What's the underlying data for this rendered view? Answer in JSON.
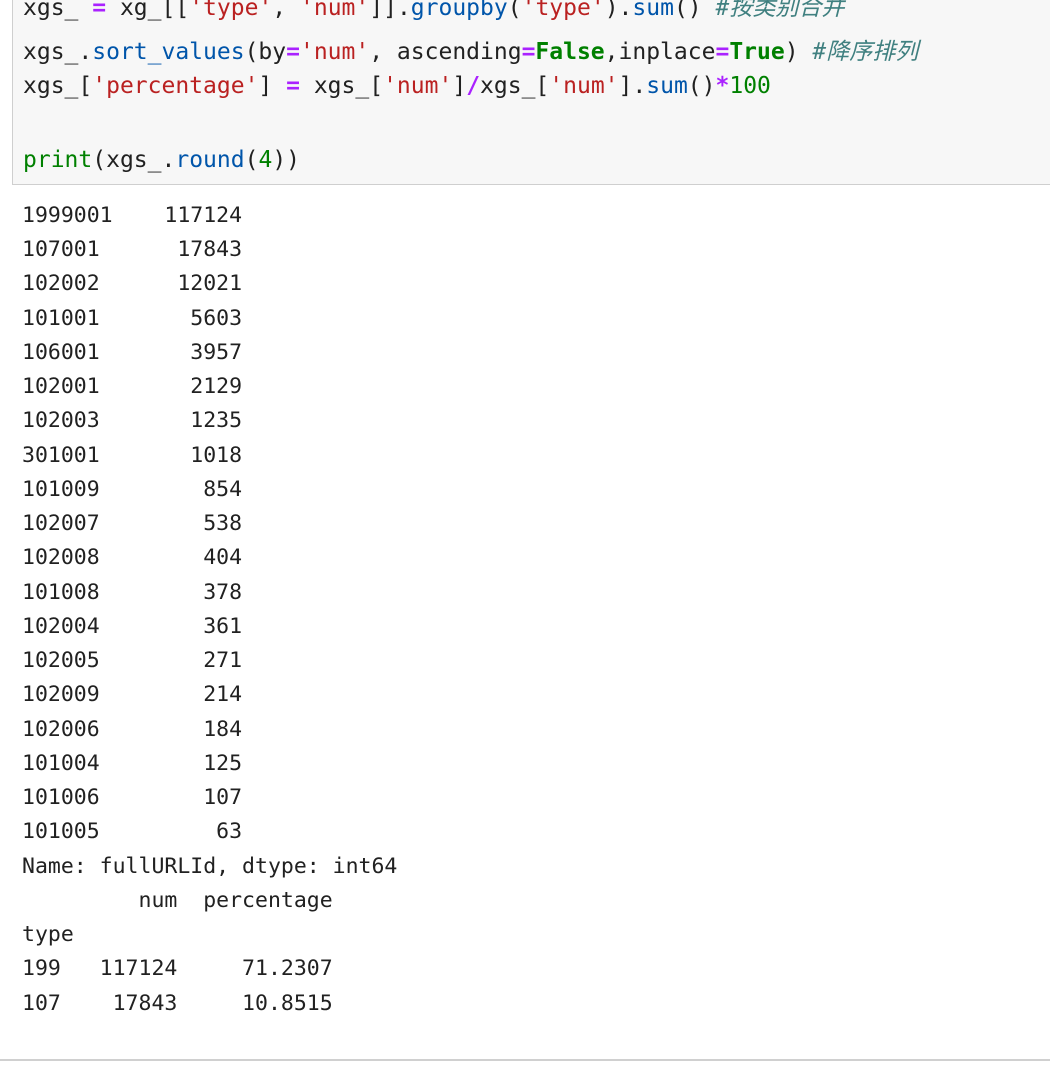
{
  "code": {
    "line1": {
      "a": "xgs_ ",
      "eq": "=",
      "b": " xg_[[",
      "s1": "'type'",
      "c": ", ",
      "s2": "'num'",
      "d": "]].",
      "m1": "groupby",
      "e": "(",
      "s3": "'type'",
      "f": ").",
      "m2": "sum",
      "g": "() ",
      "comment": "#按类别合并"
    },
    "line2": {
      "a": "xgs_.",
      "m1": "sort_values",
      "b": "(by",
      "eq1": "=",
      "s1": "'num'",
      "c": ", ascending",
      "eq2": "=",
      "k1": "False",
      "d": ",inplace",
      "eq3": "=",
      "k2": "True",
      "e": ") ",
      "comment": "#降序排列"
    },
    "line3": {
      "a": "xgs_[",
      "s1": "'percentage'",
      "b": "] ",
      "eq": "=",
      "c": " xgs_[",
      "s2": "'num'",
      "d": "]",
      "div": "/",
      "e": "xgs_[",
      "s3": "'num'",
      "f": "].",
      "m1": "sum",
      "g": "()",
      "mul": "*",
      "n": "100"
    },
    "line5": {
      "print": "print",
      "a": "(xgs_.",
      "m1": "round",
      "b": "(",
      "n": "4",
      "c": "))"
    }
  },
  "output": {
    "series_rows": [
      "1999001    117124",
      "107001      17843",
      "102002      12021",
      "101001       5603",
      "106001       3957",
      "102001       2129",
      "102003       1235",
      "301001       1018",
      "101009        854",
      "102007        538",
      "102008        404",
      "101008        378",
      "102004        361",
      "102005        271",
      "102009        214",
      "102006        184",
      "101004        125",
      "101006        107",
      "101005         63"
    ],
    "series_footer": "Name: fullURLId, dtype: int64",
    "df_header": "         num  percentage",
    "df_index_name": "type",
    "df_rows": [
      "199   117124     71.2307",
      "107    17843     10.8515"
    ]
  }
}
